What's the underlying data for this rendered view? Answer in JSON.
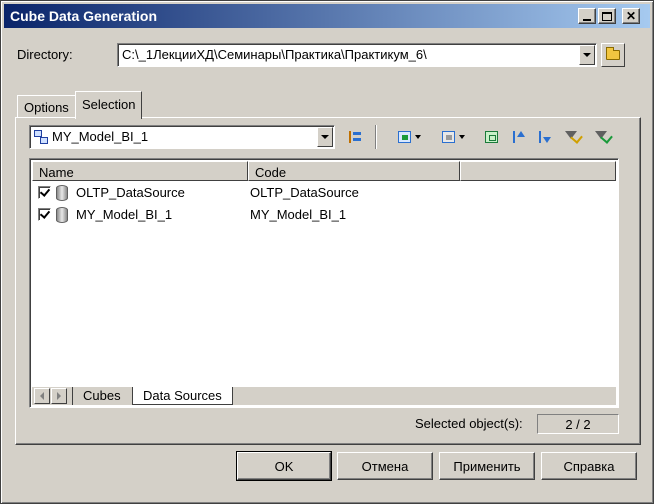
{
  "window": {
    "title": "Cube Data Generation"
  },
  "directory": {
    "label": "Directory:",
    "value": "C:\\_1ЛекцииХД\\Семинары\\Практика\\Практикум_6\\"
  },
  "tabs": [
    {
      "label": "Options"
    },
    {
      "label": "Selection"
    }
  ],
  "selection": {
    "model_combo_value": "MY_Model_BI_1",
    "columns": {
      "name": "Name",
      "code": "Code"
    },
    "rows": [
      {
        "name": "OLTP_DataSource",
        "code": "OLTP_DataSource",
        "checked": true
      },
      {
        "name": "MY_Model_BI_1",
        "code": "MY_Model_BI_1",
        "checked": true
      }
    ],
    "sheet_tabs": [
      {
        "label": "Cubes"
      },
      {
        "label": "Data Sources"
      }
    ],
    "selected_label": "Selected object(s):",
    "selected_value": "2 / 2"
  },
  "buttons": {
    "ok": "OK",
    "cancel": "Отмена",
    "apply": "Применить",
    "help": "Справка"
  }
}
